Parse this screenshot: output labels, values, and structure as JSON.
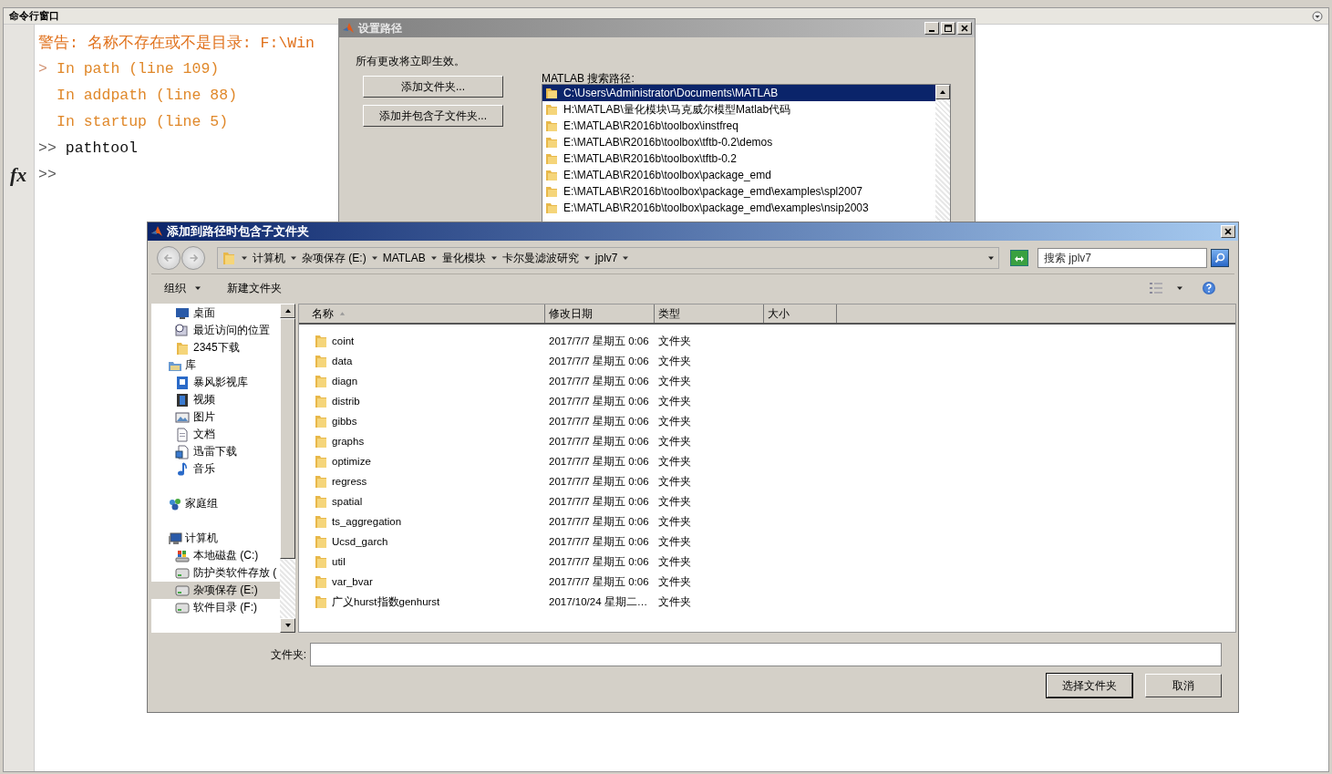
{
  "command_window": {
    "title": "命令行窗口",
    "fx_button": "fx",
    "lines": [
      {
        "kind": "warning",
        "text": "警告: 名称不存在或不是目录: F:\\Win"
      },
      {
        "kind": "trace",
        "marker": ">",
        "text": "In path (line 109)"
      },
      {
        "kind": "trace",
        "text": "In addpath (line 88)"
      },
      {
        "kind": "trace",
        "text": "In startup (line 5)"
      },
      {
        "kind": "command",
        "prompt": ">>",
        "text": "pathtool"
      },
      {
        "kind": "prompt",
        "prompt": ">>"
      }
    ]
  },
  "set_path_dialog": {
    "title": "设置路径",
    "note": "所有更改将立即生效。",
    "buttons": [
      "添加文件夹...",
      "添加并包含子文件夹..."
    ],
    "path_label": "MATLAB 搜索路径:",
    "paths": [
      {
        "text": "C:\\Users\\Administrator\\Documents\\MATLAB",
        "selected": true
      },
      {
        "text": "H:\\MATLAB\\量化模块\\马克威尔模型Matlab代码",
        "selected": false
      },
      {
        "text": "E:\\MATLAB\\R2016b\\toolbox\\instfreq",
        "selected": false
      },
      {
        "text": "E:\\MATLAB\\R2016b\\toolbox\\tftb-0.2\\demos",
        "selected": false
      },
      {
        "text": "E:\\MATLAB\\R2016b\\toolbox\\tftb-0.2",
        "selected": false
      },
      {
        "text": "E:\\MATLAB\\R2016b\\toolbox\\package_emd",
        "selected": false
      },
      {
        "text": "E:\\MATLAB\\R2016b\\toolbox\\package_emd\\examples\\spl2007",
        "selected": false
      },
      {
        "text": "E:\\MATLAB\\R2016b\\toolbox\\package_emd\\examples\\nsip2003",
        "selected": false
      }
    ]
  },
  "folder_dialog": {
    "title": "添加到路径时包含子文件夹",
    "breadcrumb": [
      "计算机",
      "杂项保存 (E:)",
      "MATLAB",
      "量化模块",
      "卡尔曼滤波研究",
      "jplv7"
    ],
    "search": {
      "placeholder": "搜索 jplv7"
    },
    "toolbar": [
      {
        "label": "组织",
        "menu": true
      },
      {
        "label": "新建文件夹",
        "menu": false
      }
    ],
    "sidebar": {
      "favorites": [
        {
          "label": "桌面",
          "kind": "desktop",
          "selected": false
        },
        {
          "label": "最近访问的位置",
          "kind": "recent",
          "selected": false
        },
        {
          "label": "2345下载",
          "kind": "folder",
          "selected": false
        }
      ],
      "groups": [
        {
          "label": "库",
          "kind": "library",
          "children": [
            {
              "label": "暴风影视库",
              "kind": "media",
              "selected": false
            },
            {
              "label": "视频",
              "kind": "video",
              "selected": false
            },
            {
              "label": "图片",
              "kind": "picture",
              "selected": false
            },
            {
              "label": "文档",
              "kind": "document",
              "selected": false
            },
            {
              "label": "迅雷下载",
              "kind": "download",
              "selected": false
            },
            {
              "label": "音乐",
              "kind": "music",
              "selected": false
            }
          ]
        },
        {
          "label": "家庭组",
          "kind": "homegroup"
        },
        {
          "label": "计算机",
          "kind": "computer",
          "children": [
            {
              "label": "本地磁盘 (C:)",
              "kind": "disk",
              "selected": false
            },
            {
              "label": "防护类软件存放 (",
              "kind": "drive",
              "selected": false
            },
            {
              "label": "杂项保存 (E:)",
              "kind": "drive",
              "selected": true
            },
            {
              "label": "软件目录 (F:)",
              "kind": "drive",
              "selected": false
            }
          ]
        }
      ]
    },
    "columns": [
      "名称",
      "修改日期",
      "类型",
      "大小"
    ],
    "rows": [
      {
        "name": "coint",
        "date": "2017/7/7 星期五 0:06",
        "type": "文件夹",
        "selected": false
      },
      {
        "name": "data",
        "date": "2017/7/7 星期五 0:06",
        "type": "文件夹",
        "selected": false
      },
      {
        "name": "diagn",
        "date": "2017/7/7 星期五 0:06",
        "type": "文件夹",
        "selected": false
      },
      {
        "name": "distrib",
        "date": "2017/7/7 星期五 0:06",
        "type": "文件夹",
        "selected": false
      },
      {
        "name": "gibbs",
        "date": "2017/7/7 星期五 0:06",
        "type": "文件夹",
        "selected": false
      },
      {
        "name": "graphs",
        "date": "2017/7/7 星期五 0:06",
        "type": "文件夹",
        "selected": false
      },
      {
        "name": "optimize",
        "date": "2017/7/7 星期五 0:06",
        "type": "文件夹",
        "selected": false
      },
      {
        "name": "regress",
        "date": "2017/7/7 星期五 0:06",
        "type": "文件夹",
        "selected": false
      },
      {
        "name": "spatial",
        "date": "2017/7/7 星期五 0:06",
        "type": "文件夹",
        "selected": false
      },
      {
        "name": "ts_aggregation",
        "date": "2017/7/7 星期五 0:06",
        "type": "文件夹",
        "selected": false
      },
      {
        "name": "Ucsd_garch",
        "date": "2017/7/7 星期五 0:06",
        "type": "文件夹",
        "selected": false
      },
      {
        "name": "util",
        "date": "2017/7/7 星期五 0:06",
        "type": "文件夹",
        "selected": false
      },
      {
        "name": "var_bvar",
        "date": "2017/7/7 星期五 0:06",
        "type": "文件夹",
        "selected": false
      },
      {
        "name": "广义hurst指数genhurst",
        "date": "2017/10/24 星期二…",
        "type": "文件夹",
        "selected": false
      }
    ],
    "folder_label": "文件夹:",
    "buttons": [
      "选择文件夹",
      "取消"
    ]
  }
}
